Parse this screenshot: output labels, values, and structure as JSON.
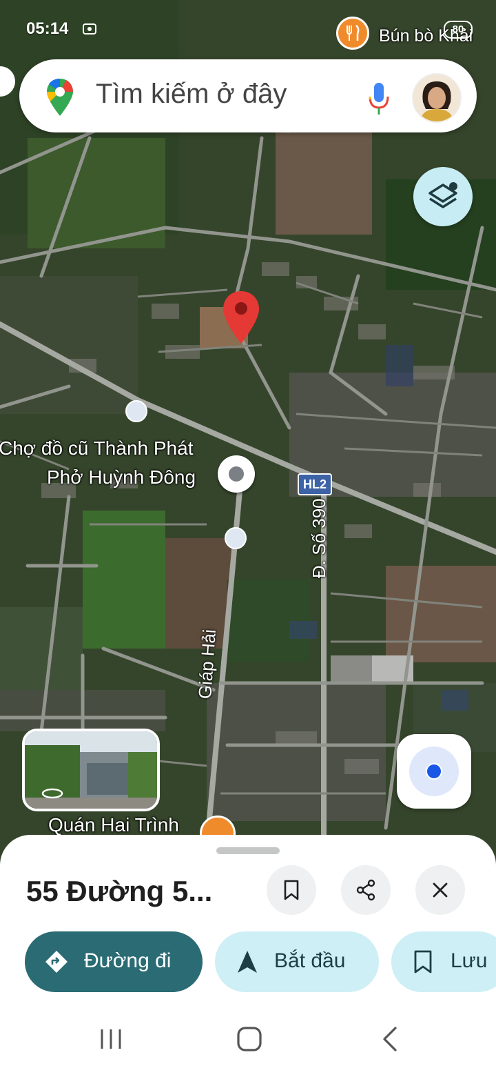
{
  "status_bar": {
    "time": "05:14",
    "battery": "80",
    "status_icons": "",
    "top_poi_label": "Bún bò Khải"
  },
  "search": {
    "placeholder": "Tìm kiếm ở đây"
  },
  "map": {
    "labels": {
      "cho_do_cu": "Chợ đồ cũ Thành Phát",
      "pho_huynh_dong": "Phở Huỳnh Đông",
      "hl2": "HL2",
      "duong_so_390": "Đ. Số 390",
      "giap_hai": "Giáp Hải",
      "quan_hai_trinh": "Quán Hai Trình"
    }
  },
  "sheet": {
    "title": "55 Đường 5...",
    "buttons": {
      "directions": "Đường đi",
      "start": "Bắt đầu",
      "save": "Lưu"
    }
  },
  "colors": {
    "primary_chip": "#2a6b74",
    "secondary_chip": "#cdeff5",
    "pin_red": "#e53935",
    "poi_orange": "#f08b2c",
    "location_blue": "#1a57e6"
  }
}
